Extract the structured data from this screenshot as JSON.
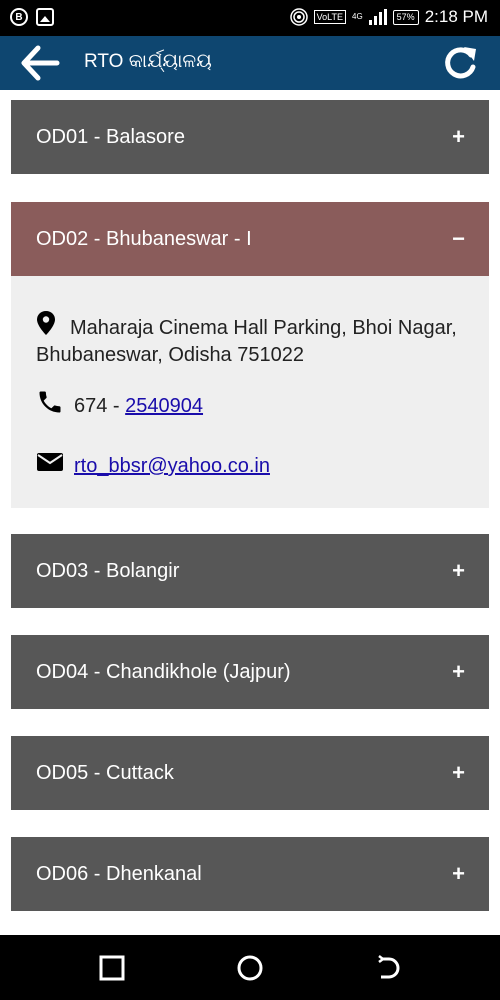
{
  "status_bar": {
    "left_badge": "B",
    "volte": "VoLTE",
    "network": "4G",
    "battery": "57%",
    "time": "2:18 PM"
  },
  "app_bar": {
    "title": "RTO କାର୍ଯ୍ୟାଳୟ"
  },
  "offices": [
    {
      "title": "OD01 - Balasore",
      "sign": "+"
    },
    {
      "title": "OD02 - Bhubaneswar - I",
      "sign": "−"
    },
    {
      "title": "OD03 - Bolangir",
      "sign": "+"
    },
    {
      "title": "OD04 - Chandikhole (Jajpur)",
      "sign": "+"
    },
    {
      "title": "OD05 - Cuttack",
      "sign": "+"
    },
    {
      "title": "OD06 - Dhenkanal",
      "sign": "+"
    }
  ],
  "expanded": {
    "address": "Maharaja Cinema Hall Parking, Bhoi Nagar, Bhubaneswar, Odisha 751022",
    "phone_prefix": "674 - ",
    "phone_number": "2540904",
    "email": "rto_bbsr@yahoo.co.in"
  },
  "colors": {
    "app_bar": "#0e4670",
    "panel": "#575757",
    "panel_active": "#8a5c5b",
    "detail_bg": "#efefef",
    "link": "#1a0dab"
  }
}
